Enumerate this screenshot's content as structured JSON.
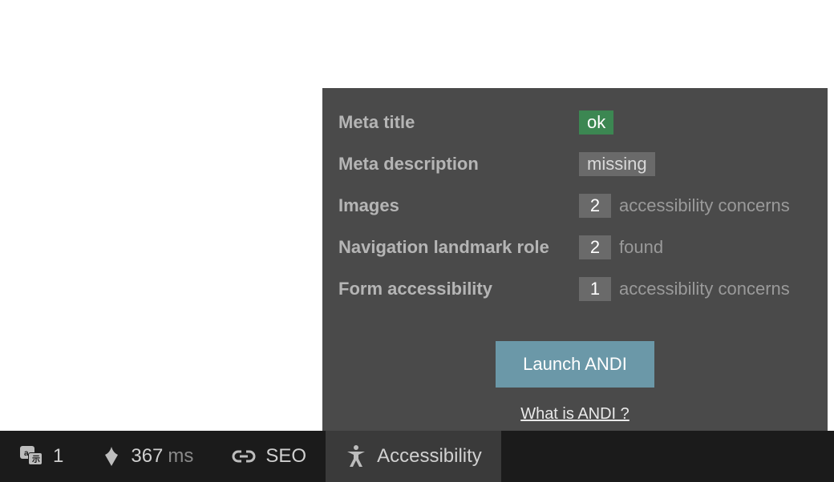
{
  "panel": {
    "rows": [
      {
        "label": "Meta title",
        "badge_type": "ok",
        "badge_text": "ok",
        "suffix": ""
      },
      {
        "label": "Meta description",
        "badge_type": "missing",
        "badge_text": "missing",
        "suffix": ""
      },
      {
        "label": "Images",
        "badge_type": "count",
        "badge_text": "2",
        "suffix": "accessibility concerns"
      },
      {
        "label": "Navigation landmark role",
        "badge_type": "count",
        "badge_text": "2",
        "suffix": "found"
      },
      {
        "label": "Form accessibility",
        "badge_type": "count",
        "badge_text": "1",
        "suffix": "accessibility concerns"
      }
    ],
    "launch_button": "Launch ANDI",
    "andi_link": "What is ANDI ?"
  },
  "bottombar": {
    "translate_count": "1",
    "load_time_value": "367",
    "load_time_unit": "ms",
    "seo_label": "SEO",
    "accessibility_label": "Accessibility"
  }
}
